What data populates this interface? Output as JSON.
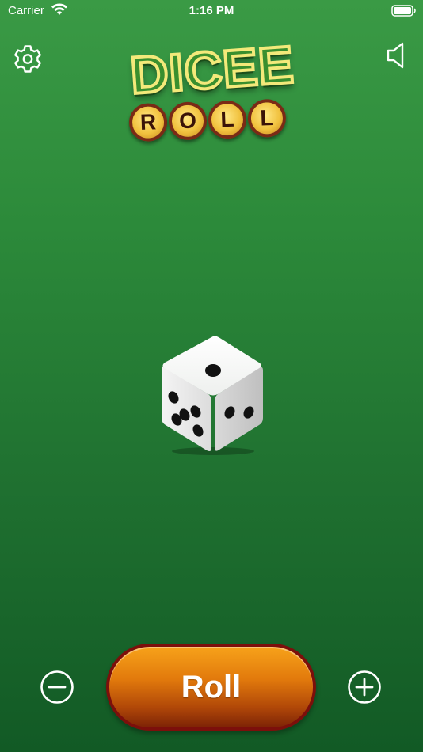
{
  "status_bar": {
    "carrier": "Carrier",
    "time": "1:16 PM"
  },
  "header": {
    "logo_top": "DICEE",
    "logo_bottom": [
      "R",
      "O",
      "L",
      "L"
    ],
    "settings_icon": "gear-icon",
    "sound_icon": "speaker-icon"
  },
  "die": {
    "top_face": 1,
    "left_face": 5,
    "right_face": 2
  },
  "controls": {
    "roll_label": "Roll",
    "decrease_icon": "minus-circle-icon",
    "increase_icon": "plus-circle-icon"
  },
  "colors": {
    "background": "#2c8a3a",
    "roll_button": "#e27a0c",
    "roll_border": "#7c0f0b"
  }
}
